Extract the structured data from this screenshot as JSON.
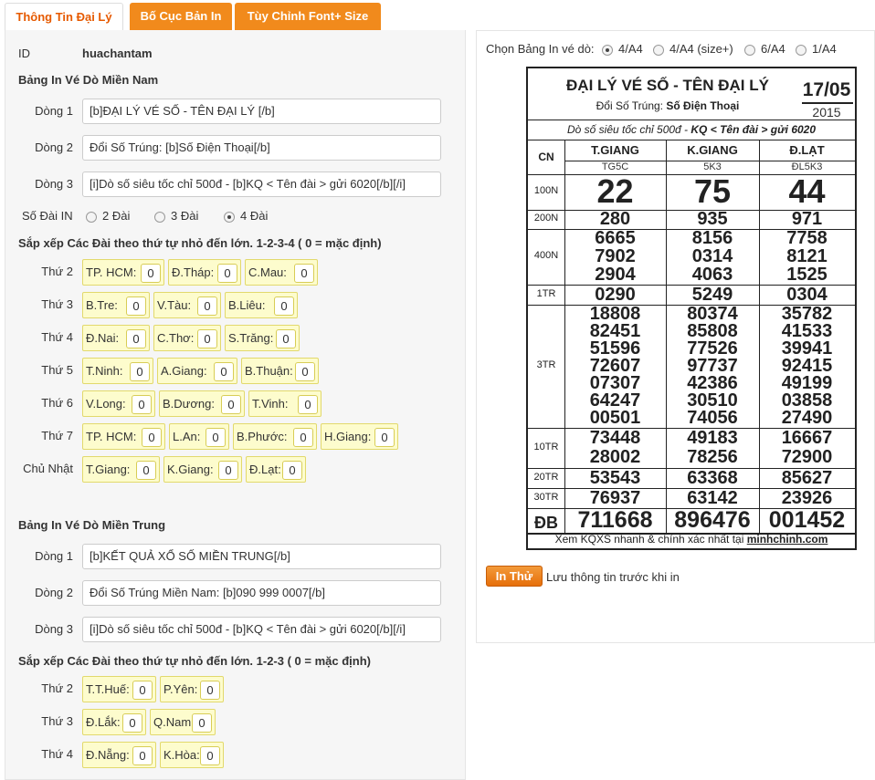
{
  "tabs": [
    "Thông Tin Đại Lý",
    "Bố Cục Bản In",
    "Tùy Chỉnh Font+ Size"
  ],
  "form": {
    "id_label": "ID",
    "id_value": "huachantam",
    "south_heading": "Bảng In Vé Dò Miền Nam",
    "south_lines": [
      {
        "label": "Dòng 1",
        "value": "[b]ĐẠI LÝ VÉ SỐ - TÊN ĐẠI LÝ [/b]"
      },
      {
        "label": "Dòng 2",
        "value": "Đổi Số Trúng: [b]Số Điện Thoại[/b]"
      },
      {
        "label": "Dòng 3",
        "value": "[i]Dò số siêu tốc chỉ 500đ - [b]KQ < Tên đài > gửi 6020[/b][/i]"
      }
    ],
    "so_dai_label": "Số Đài IN",
    "so_dai_options": [
      "2 Đài",
      "3 Đài",
      "4 Đài"
    ],
    "south_sort_heading": "Sắp xếp Các Đài theo thứ tự nhỏ đến lớn. 1-2-3-4 ( 0 = mặc định)",
    "south_days": [
      {
        "label": "Thứ 2",
        "items": [
          {
            "name": "TP. HCM:",
            "v": "0"
          },
          {
            "name": "Đ.Tháp:",
            "v": "0"
          },
          {
            "name": "C.Mau:",
            "v": "0"
          }
        ]
      },
      {
        "label": "Thứ 3",
        "items": [
          {
            "name": "B.Tre:",
            "v": "0"
          },
          {
            "name": "V.Tàu:",
            "v": "0"
          },
          {
            "name": "B.Liêu:",
            "v": "0"
          }
        ]
      },
      {
        "label": "Thứ 4",
        "items": [
          {
            "name": "Đ.Nai:",
            "v": "0"
          },
          {
            "name": "C.Thơ:",
            "v": "0"
          },
          {
            "name": "S.Trăng:",
            "v": "0"
          }
        ]
      },
      {
        "label": "Thứ 5",
        "items": [
          {
            "name": "T.Ninh:",
            "v": "0"
          },
          {
            "name": "A.Giang:",
            "v": "0"
          },
          {
            "name": "B.Thuận:",
            "v": "0"
          }
        ]
      },
      {
        "label": "Thứ 6",
        "items": [
          {
            "name": "V.Long:",
            "v": "0"
          },
          {
            "name": "B.Dương:",
            "v": "0"
          },
          {
            "name": "T.Vinh:",
            "v": "0"
          }
        ]
      },
      {
        "label": "Thứ 7",
        "items": [
          {
            "name": "TP. HCM:",
            "v": "0"
          },
          {
            "name": "L.An:",
            "v": "0"
          },
          {
            "name": "B.Phước:",
            "v": "0"
          },
          {
            "name": "H.Giang:",
            "v": "0"
          }
        ]
      },
      {
        "label": "Chủ Nhật",
        "items": [
          {
            "name": "T.Giang:",
            "v": "0"
          },
          {
            "name": "K.Giang:",
            "v": "0"
          },
          {
            "name": "Đ.Lạt:",
            "v": "0"
          }
        ]
      }
    ],
    "central_heading": "Bảng In Vé Dò Miền Trung",
    "central_lines": [
      {
        "label": "Dòng 1",
        "value": "[b]KẾT QUẢ XỔ SỐ MIỀN TRUNG[/b]"
      },
      {
        "label": "Dòng 2",
        "value": "Đổi Số Trúng Miền Nam: [b]090 999 0007[/b]"
      },
      {
        "label": "Dòng 3",
        "value": "[i]Dò số siêu tốc chỉ 500đ - [b]KQ < Tên đài > gửi 6020[/b][/i]"
      }
    ],
    "central_sort_heading": "Sắp xếp Các Đài theo thứ tự nhỏ đến lớn. 1-2-3 ( 0 = mặc định)",
    "central_days": [
      {
        "label": "Thứ 2",
        "items": [
          {
            "name": "T.T.Huế:",
            "v": "0"
          },
          {
            "name": "P.Yên:",
            "v": "0"
          }
        ]
      },
      {
        "label": "Thứ 3",
        "items": [
          {
            "name": "Đ.Lắk:",
            "v": "0"
          },
          {
            "name": "Q.Nam:",
            "v": "0"
          }
        ]
      },
      {
        "label": "Thứ 4",
        "items": [
          {
            "name": "Đ.Nẵng:",
            "v": "0"
          },
          {
            "name": "K.Hòa:",
            "v": "0"
          }
        ]
      }
    ]
  },
  "print": {
    "choose_label": "Chọn Bảng In vé dò:",
    "options": [
      "4/A4",
      "4/A4 (size+)",
      "6/A4",
      "1/A4"
    ],
    "selected": "4/A4",
    "button": "In Thử",
    "note": "Lưu thông tin trước khi in"
  },
  "ticket": {
    "title": "ĐẠI LÝ VÉ SỐ - TÊN ĐẠI LÝ",
    "subtitle_prefix": "Đổi Số Trúng:",
    "subtitle_value": "Số Điện Thoại",
    "date": "17/05",
    "year": "2015",
    "promo_prefix": "Dò số siêu tốc chỉ 500đ - ",
    "promo_bold": "KQ < Tên đài > gửi 6020",
    "cn": "CN",
    "stations": [
      {
        "name": "T.GIANG",
        "code": "TG5C"
      },
      {
        "name": "K.GIANG",
        "code": "5K3"
      },
      {
        "name": "Đ.LẠT",
        "code": "ĐL5K3"
      }
    ],
    "prizes": [
      {
        "label": "100N",
        "rows": [
          [
            "22",
            "75",
            "44"
          ]
        ]
      },
      {
        "label": "200N",
        "rows": [
          [
            "280",
            "935",
            "971"
          ]
        ]
      },
      {
        "label": "400N",
        "rows": [
          [
            "6665",
            "8156",
            "7758"
          ],
          [
            "7902",
            "0314",
            "8121"
          ],
          [
            "2904",
            "4063",
            "1525"
          ]
        ]
      },
      {
        "label": "1TR",
        "rows": [
          [
            "0290",
            "5249",
            "0304"
          ]
        ]
      },
      {
        "label": "3TR",
        "rows": [
          [
            "18808",
            "80374",
            "35782"
          ],
          [
            "82451",
            "85808",
            "41533"
          ],
          [
            "51596",
            "77526",
            "39941"
          ],
          [
            "72607",
            "97737",
            "92415"
          ],
          [
            "07307",
            "42386",
            "49199"
          ],
          [
            "64247",
            "30510",
            "03858"
          ],
          [
            "00501",
            "74056",
            "27490"
          ]
        ]
      },
      {
        "label": "10TR",
        "rows": [
          [
            "73448",
            "49183",
            "16667"
          ],
          [
            "28002",
            "78256",
            "72900"
          ]
        ]
      },
      {
        "label": "20TR",
        "rows": [
          [
            "53543",
            "63368",
            "85627"
          ]
        ]
      },
      {
        "label": "30TR",
        "rows": [
          [
            "76937",
            "63142",
            "23926"
          ]
        ]
      },
      {
        "label": "ĐB",
        "rows": [
          [
            "711668",
            "896476",
            "001452"
          ]
        ]
      }
    ],
    "footer_prefix": "Xem KQXS nhanh & chính xác nhất tại ",
    "footer_link": "minhchinh.com"
  }
}
